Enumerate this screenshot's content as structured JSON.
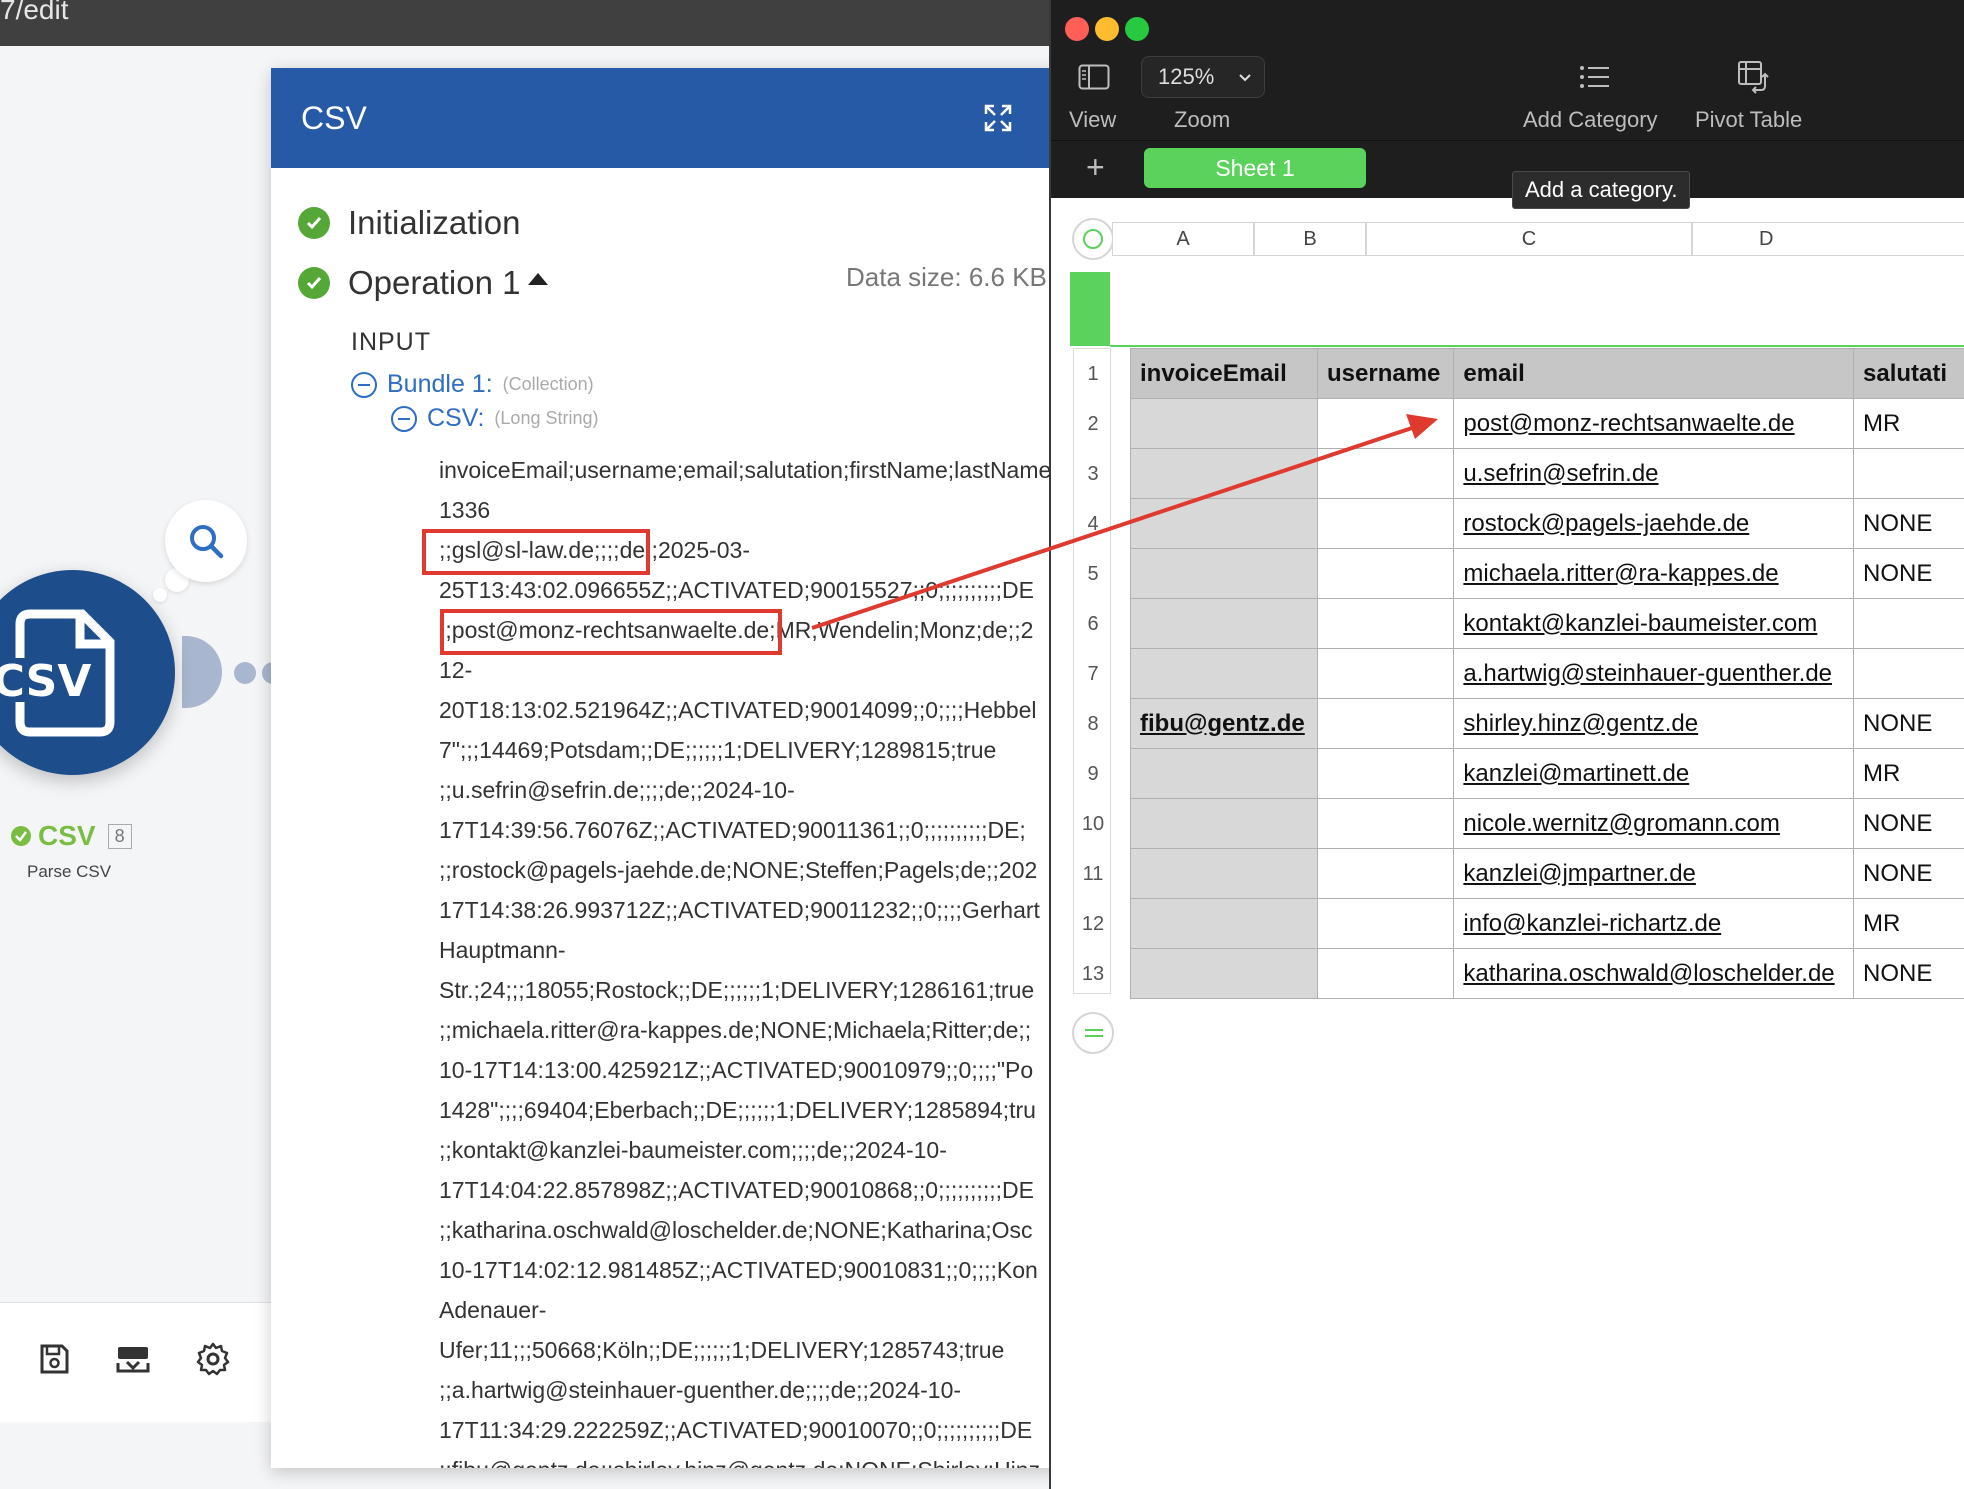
{
  "browser": {
    "url_fragment": "7/edit"
  },
  "canvas": {
    "module": {
      "name": "CSV",
      "count": "8",
      "subtitle": "Parse CSV",
      "icon": "csv-file-icon"
    }
  },
  "panel": {
    "title": "CSV",
    "initialization_label": "Initialization",
    "operation_label": "Operation 1",
    "data_size": "Data size: 6.6 KB",
    "input_label": "INPUT",
    "bundle_key": "Bundle 1:",
    "bundle_type": "(Collection)",
    "csv_key": "CSV:",
    "csv_type": "(Long String)",
    "csv_lines": [
      "invoiceEmail;username;email;salutation;firstName;lastName",
      "1336",
      ";;gsl@sl-law.de;;;;de;;2025-03-",
      "25T13:43:02.096655Z;;ACTIVATED;90015527;;0;;;;;;;;;;DE",
      ";;post@monz-rechtsanwaelte.de;MR;Wendelin;Monz;de;;2",
      "12-",
      "20T18:13:02.521964Z;;ACTIVATED;90014099;;0;;;;Hebbel",
      "7\";;;14469;Potsdam;;DE;;;;;;1;DELIVERY;1289815;true",
      ";;u.sefrin@sefrin.de;;;;de;;2024-10-",
      "17T14:39:56.76076Z;;ACTIVATED;90011361;;0;;;;;;;;;;DE;",
      ";;rostock@pagels-jaehde.de;NONE;Steffen;Pagels;de;;202",
      "17T14:38:26.993712Z;;ACTIVATED;90011232;;0;;;;Gerhart",
      "Hauptmann-",
      "Str.;24;;;18055;Rostock;;DE;;;;;;1;DELIVERY;1286161;true",
      ";;michaela.ritter@ra-kappes.de;NONE;Michaela;Ritter;de;;",
      "10-17T14:13:00.425921Z;;ACTIVATED;90010979;;0;;;;\"Po",
      "1428\";;;;69404;Eberbach;;DE;;;;;;1;DELIVERY;1285894;tru",
      ";;kontakt@kanzlei-baumeister.com;;;;de;;2024-10-",
      "17T14:04:22.857898Z;;ACTIVATED;90010868;;0;;;;;;;;;;DE",
      ";;katharina.oschwald@loschelder.de;NONE;Katharina;Osc",
      "10-17T14:02:12.981485Z;;ACTIVATED;90010831;;0;;;;Kon",
      "Adenauer-",
      "Ufer;11;;;50668;Köln;;DE;;;;;;1;DELIVERY;1285743;true",
      ";;a.hartwig@steinhauer-guenther.de;;;;de;;2024-10-",
      "17T11:34:29.222259Z;;ACTIVATED;90010070;;0;;;;;;;;;;DE",
      ";;fibu@gentz.de;;shirley.hinz@gentz.de;NONE;Shirley;Hinz"
    ]
  },
  "numbers": {
    "view_label": "View",
    "zoom_value": "125%",
    "zoom_label": "Zoom",
    "add_category_label": "Add Category",
    "pivot_table_label": "Pivot Table",
    "add_sheet": "+",
    "sheet_tab": "Sheet 1",
    "tooltip": "Add a category.",
    "columns": [
      "A",
      "B",
      "C",
      "D"
    ],
    "header_row": [
      "invoiceEmail",
      "username",
      "email",
      "salutati"
    ],
    "rows": [
      {
        "num": "1"
      },
      {
        "num": "2",
        "invoiceEmail": "",
        "username": "",
        "email": "post@monz-rechtsanwaelte.de",
        "salutation": "MR"
      },
      {
        "num": "3",
        "invoiceEmail": "",
        "username": "",
        "email": "u.sefrin@sefrin.de",
        "salutation": ""
      },
      {
        "num": "4",
        "invoiceEmail": "",
        "username": "",
        "email": "rostock@pagels-jaehde.de",
        "salutation": "NONE"
      },
      {
        "num": "5",
        "invoiceEmail": "",
        "username": "",
        "email": "michaela.ritter@ra-kappes.de",
        "salutation": "NONE"
      },
      {
        "num": "6",
        "invoiceEmail": "",
        "username": "",
        "email": "kontakt@kanzlei-baumeister.com",
        "salutation": ""
      },
      {
        "num": "7",
        "invoiceEmail": "",
        "username": "",
        "email": "a.hartwig@steinhauer-guenther.de",
        "salutation": ""
      },
      {
        "num": "8",
        "invoiceEmail": "fibu@gentz.de",
        "username": "",
        "email": "shirley.hinz@gentz.de",
        "salutation": "NONE"
      },
      {
        "num": "9",
        "invoiceEmail": "",
        "username": "",
        "email": "kanzlei@martinett.de",
        "salutation": "MR"
      },
      {
        "num": "10",
        "invoiceEmail": "",
        "username": "",
        "email": "nicole.wernitz@gromann.com",
        "salutation": "NONE"
      },
      {
        "num": "11",
        "invoiceEmail": "",
        "username": "",
        "email": "kanzlei@jmpartner.de",
        "salutation": "NONE"
      },
      {
        "num": "12",
        "invoiceEmail": "",
        "username": "",
        "email": "info@kanzlei-richartz.de",
        "salutation": "MR"
      },
      {
        "num": "13",
        "invoiceEmail": "",
        "username": "",
        "email": "katharina.oschwald@loschelder.de",
        "salutation": "NONE"
      }
    ]
  },
  "colors": {
    "panel_header": "#2659a6",
    "check_green": "#55a838",
    "highlight_red": "#e03a2f",
    "sheet_green": "#5bd25b",
    "module_blue": "#1e4d8c"
  }
}
